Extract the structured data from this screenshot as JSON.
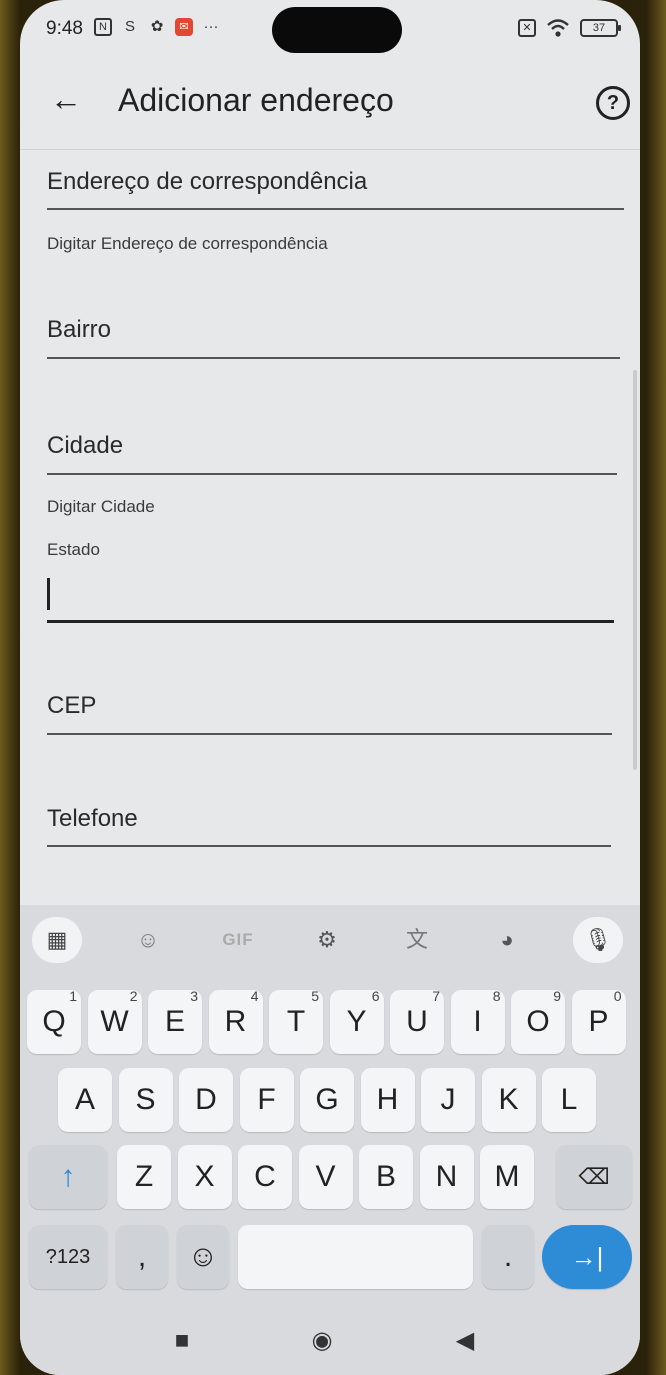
{
  "status_bar": {
    "time": "9:48",
    "left_icons": [
      "nfc-icon",
      "sync-icon",
      "settings-gear-icon",
      "mail-app-icon",
      "more-dots-icon"
    ],
    "right_icons": [
      "no-sim-icon",
      "wifi-icon"
    ],
    "battery": "37"
  },
  "app_bar": {
    "back_icon": "arrow-left-icon",
    "title": "Adicionar endereço",
    "help_icon": "help-circle-icon"
  },
  "form": {
    "mailing_address": {
      "label": "Endereço de correspondência",
      "helper": "Digitar Endereço de correspondência"
    },
    "neighborhood": {
      "label": "Bairro"
    },
    "city": {
      "label": "Cidade",
      "helper": "Digitar Cidade"
    },
    "state": {
      "label": "Estado",
      "value": ""
    },
    "zip": {
      "label": "CEP"
    },
    "phone": {
      "label": "Telefone"
    }
  },
  "keyboard": {
    "toolbar": [
      "apps-grid-icon",
      "sticker-icon",
      "GIF",
      "settings-icon",
      "translate-icon",
      "palette-icon",
      "microphone-icon"
    ],
    "gif_label": "GIF",
    "row1": [
      {
        "key": "Q",
        "hint": "1"
      },
      {
        "key": "W",
        "hint": "2"
      },
      {
        "key": "E",
        "hint": "3"
      },
      {
        "key": "R",
        "hint": "4"
      },
      {
        "key": "T",
        "hint": "5"
      },
      {
        "key": "Y",
        "hint": "6"
      },
      {
        "key": "U",
        "hint": "7"
      },
      {
        "key": "I",
        "hint": "8"
      },
      {
        "key": "O",
        "hint": "9"
      },
      {
        "key": "P",
        "hint": "0"
      }
    ],
    "row2": [
      "A",
      "S",
      "D",
      "F",
      "G",
      "H",
      "J",
      "K",
      "L"
    ],
    "row3": [
      "Z",
      "X",
      "C",
      "V",
      "B",
      "N",
      "M"
    ],
    "shift_icon": "arrow-up-icon",
    "backspace_icon": "backspace-icon",
    "symbols_label": "?123",
    "comma_label": ",",
    "emoji_icon": "emoji-icon",
    "period_label": ".",
    "enter_icon": "tab-arrow-icon"
  },
  "nav_bar": [
    "recents-square-icon",
    "home-circle-icon",
    "back-triangle-icon"
  ]
}
